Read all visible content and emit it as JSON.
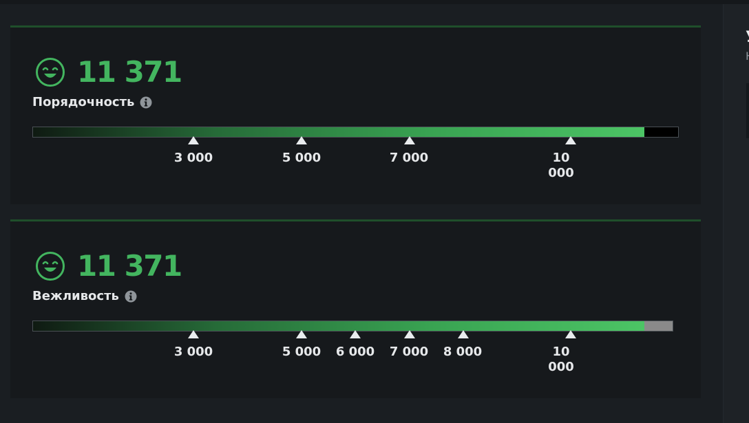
{
  "right_panel": {
    "title_fragment": "У",
    "subtitle_fragment": "Н"
  },
  "panels": [
    {
      "score": "11 371",
      "label": "Порядочность",
      "icon": "smiley-face-icon",
      "progress_fraction": 0.946,
      "bar_track_color": "#000000",
      "markers": [
        "3 000",
        "5 000",
        "7 000",
        "10 000"
      ]
    },
    {
      "score": "11 371",
      "label": "Вежливость",
      "icon": "smiley-face-icon",
      "progress_fraction": 0.952,
      "bar_track_color": "#8a8a8a",
      "markers": [
        "3 000",
        "5 000",
        "6 000",
        "7 000",
        "8 000",
        "10 000"
      ]
    }
  ],
  "colors": {
    "accent_green": "#43b55f",
    "panel_border": "#1f4f2b",
    "background": "#1a1e22"
  }
}
